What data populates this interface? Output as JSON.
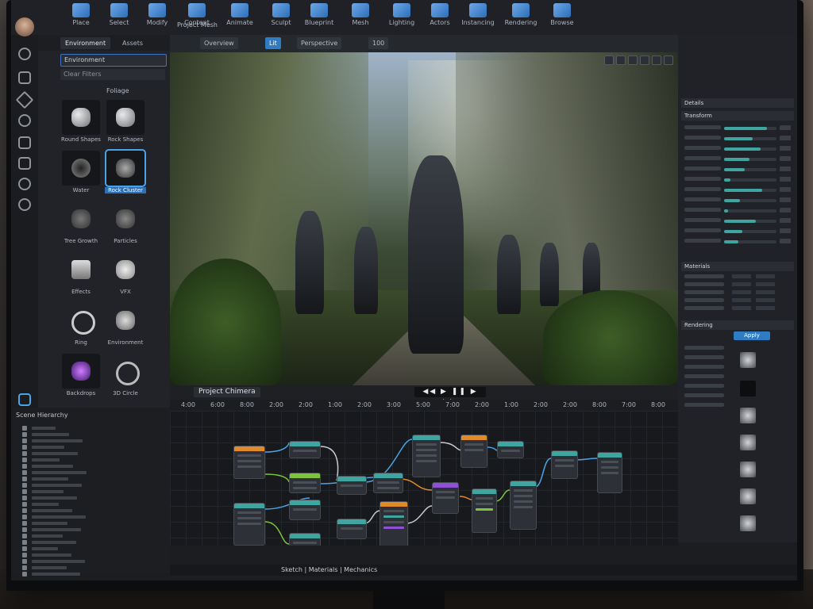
{
  "app": {
    "project_name": "Project Chimera",
    "status_text": "Sketch | Materials | Mechanics"
  },
  "toolbar": {
    "items": [
      "Place",
      "Select",
      "Modify",
      "Content",
      "Animate",
      "Sculpt",
      "Blueprint",
      "Mesh",
      "Lighting",
      "Actors",
      "Instancing",
      "Rendering",
      "Browse"
    ]
  },
  "subbar": {
    "project_label": "Project Mesh",
    "mode_label": "Overview",
    "view_label": "Lit",
    "perspective_label": "Perspective",
    "scale_value": "100"
  },
  "browser": {
    "tabs": [
      "Environment",
      "Assets"
    ],
    "search_value": "Environment",
    "filter_value": "Clear Filters",
    "section_label": "Foliage",
    "items": [
      {
        "label": "Round Shapes",
        "selected": false
      },
      {
        "label": "Rock Shapes",
        "selected": false
      },
      {
        "label": "Water",
        "selected": false
      },
      {
        "label": "Rock Cluster",
        "selected": true
      },
      {
        "label": "Tree Growth",
        "selected": false
      },
      {
        "label": "Particles",
        "selected": false
      },
      {
        "label": "Effects",
        "selected": false
      },
      {
        "label": "VFX",
        "selected": false
      },
      {
        "label": "Ring",
        "selected": false
      },
      {
        "label": "Environment",
        "selected": false
      },
      {
        "label": "Backdrops",
        "selected": false
      },
      {
        "label": "3D Circle",
        "selected": false
      }
    ]
  },
  "details": {
    "header": "Details",
    "section_transform": "Transform",
    "section_materials": "Materials",
    "section_rendering": "Rendering",
    "apply_label": "Apply",
    "slider_values": [
      0.82,
      0.55,
      0.7,
      0.48,
      0.4,
      0.12,
      0.72,
      0.3,
      0.08,
      0.6,
      0.35,
      0.28
    ]
  },
  "timeline": {
    "ruler_labels": [
      "4:00",
      "6:00",
      "8:00",
      "2:00",
      "2:00",
      "1:00",
      "2:00",
      "3:00",
      "5:00",
      "7:00",
      "2:00",
      "1:00",
      "2:00",
      "2:00",
      "8:00",
      "7:00",
      "8:00"
    ]
  },
  "outliner": {
    "header": "Scene Hierarchy",
    "rows": 24
  },
  "colors": {
    "accent": "#2e7cc4",
    "teal": "#3fa5a0",
    "node_orange": "#e08a2a",
    "node_green": "#7cc43a",
    "node_purple": "#8f4fd6"
  }
}
